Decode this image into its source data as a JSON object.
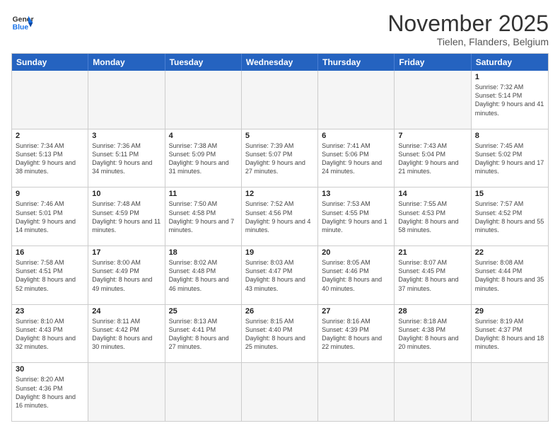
{
  "logo": {
    "text_general": "General",
    "text_blue": "Blue"
  },
  "title": "November 2025",
  "subtitle": "Tielen, Flanders, Belgium",
  "header_days": [
    "Sunday",
    "Monday",
    "Tuesday",
    "Wednesday",
    "Thursday",
    "Friday",
    "Saturday"
  ],
  "weeks": [
    [
      {
        "day": "",
        "empty": true
      },
      {
        "day": "",
        "empty": true
      },
      {
        "day": "",
        "empty": true
      },
      {
        "day": "",
        "empty": true
      },
      {
        "day": "",
        "empty": true
      },
      {
        "day": "",
        "empty": true
      },
      {
        "day": "1",
        "info": "Sunrise: 7:32 AM\nSunset: 5:14 PM\nDaylight: 9 hours\nand 41 minutes."
      }
    ],
    [
      {
        "day": "2",
        "info": "Sunrise: 7:34 AM\nSunset: 5:13 PM\nDaylight: 9 hours\nand 38 minutes."
      },
      {
        "day": "3",
        "info": "Sunrise: 7:36 AM\nSunset: 5:11 PM\nDaylight: 9 hours\nand 34 minutes."
      },
      {
        "day": "4",
        "info": "Sunrise: 7:38 AM\nSunset: 5:09 PM\nDaylight: 9 hours\nand 31 minutes."
      },
      {
        "day": "5",
        "info": "Sunrise: 7:39 AM\nSunset: 5:07 PM\nDaylight: 9 hours\nand 27 minutes."
      },
      {
        "day": "6",
        "info": "Sunrise: 7:41 AM\nSunset: 5:06 PM\nDaylight: 9 hours\nand 24 minutes."
      },
      {
        "day": "7",
        "info": "Sunrise: 7:43 AM\nSunset: 5:04 PM\nDaylight: 9 hours\nand 21 minutes."
      },
      {
        "day": "8",
        "info": "Sunrise: 7:45 AM\nSunset: 5:02 PM\nDaylight: 9 hours\nand 17 minutes."
      }
    ],
    [
      {
        "day": "9",
        "info": "Sunrise: 7:46 AM\nSunset: 5:01 PM\nDaylight: 9 hours\nand 14 minutes."
      },
      {
        "day": "10",
        "info": "Sunrise: 7:48 AM\nSunset: 4:59 PM\nDaylight: 9 hours\nand 11 minutes."
      },
      {
        "day": "11",
        "info": "Sunrise: 7:50 AM\nSunset: 4:58 PM\nDaylight: 9 hours\nand 7 minutes."
      },
      {
        "day": "12",
        "info": "Sunrise: 7:52 AM\nSunset: 4:56 PM\nDaylight: 9 hours\nand 4 minutes."
      },
      {
        "day": "13",
        "info": "Sunrise: 7:53 AM\nSunset: 4:55 PM\nDaylight: 9 hours\nand 1 minute."
      },
      {
        "day": "14",
        "info": "Sunrise: 7:55 AM\nSunset: 4:53 PM\nDaylight: 8 hours\nand 58 minutes."
      },
      {
        "day": "15",
        "info": "Sunrise: 7:57 AM\nSunset: 4:52 PM\nDaylight: 8 hours\nand 55 minutes."
      }
    ],
    [
      {
        "day": "16",
        "info": "Sunrise: 7:58 AM\nSunset: 4:51 PM\nDaylight: 8 hours\nand 52 minutes."
      },
      {
        "day": "17",
        "info": "Sunrise: 8:00 AM\nSunset: 4:49 PM\nDaylight: 8 hours\nand 49 minutes."
      },
      {
        "day": "18",
        "info": "Sunrise: 8:02 AM\nSunset: 4:48 PM\nDaylight: 8 hours\nand 46 minutes."
      },
      {
        "day": "19",
        "info": "Sunrise: 8:03 AM\nSunset: 4:47 PM\nDaylight: 8 hours\nand 43 minutes."
      },
      {
        "day": "20",
        "info": "Sunrise: 8:05 AM\nSunset: 4:46 PM\nDaylight: 8 hours\nand 40 minutes."
      },
      {
        "day": "21",
        "info": "Sunrise: 8:07 AM\nSunset: 4:45 PM\nDaylight: 8 hours\nand 37 minutes."
      },
      {
        "day": "22",
        "info": "Sunrise: 8:08 AM\nSunset: 4:44 PM\nDaylight: 8 hours\nand 35 minutes."
      }
    ],
    [
      {
        "day": "23",
        "info": "Sunrise: 8:10 AM\nSunset: 4:43 PM\nDaylight: 8 hours\nand 32 minutes."
      },
      {
        "day": "24",
        "info": "Sunrise: 8:11 AM\nSunset: 4:42 PM\nDaylight: 8 hours\nand 30 minutes."
      },
      {
        "day": "25",
        "info": "Sunrise: 8:13 AM\nSunset: 4:41 PM\nDaylight: 8 hours\nand 27 minutes."
      },
      {
        "day": "26",
        "info": "Sunrise: 8:15 AM\nSunset: 4:40 PM\nDaylight: 8 hours\nand 25 minutes."
      },
      {
        "day": "27",
        "info": "Sunrise: 8:16 AM\nSunset: 4:39 PM\nDaylight: 8 hours\nand 22 minutes."
      },
      {
        "day": "28",
        "info": "Sunrise: 8:18 AM\nSunset: 4:38 PM\nDaylight: 8 hours\nand 20 minutes."
      },
      {
        "day": "29",
        "info": "Sunrise: 8:19 AM\nSunset: 4:37 PM\nDaylight: 8 hours\nand 18 minutes."
      }
    ],
    [
      {
        "day": "30",
        "info": "Sunrise: 8:20 AM\nSunset: 4:36 PM\nDaylight: 8 hours\nand 16 minutes."
      },
      {
        "day": "",
        "empty": true
      },
      {
        "day": "",
        "empty": true
      },
      {
        "day": "",
        "empty": true
      },
      {
        "day": "",
        "empty": true
      },
      {
        "day": "",
        "empty": true
      },
      {
        "day": "",
        "empty": true
      }
    ]
  ]
}
